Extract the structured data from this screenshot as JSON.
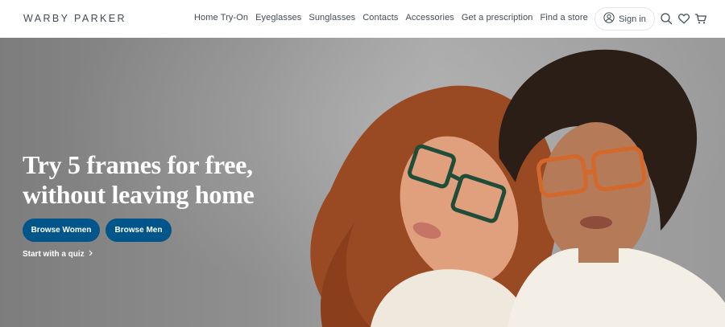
{
  "header": {
    "logo": "WARBY PARKER",
    "nav": [
      {
        "label": "Home Try-On"
      },
      {
        "label": "Eyeglasses"
      },
      {
        "label": "Sunglasses"
      },
      {
        "label": "Contacts"
      },
      {
        "label": "Accessories"
      },
      {
        "label": "Get a prescription"
      },
      {
        "label": "Find a store"
      }
    ],
    "signin_label": "Sign in",
    "icons": [
      "user-icon",
      "search-icon",
      "heart-icon",
      "cart-icon"
    ]
  },
  "hero": {
    "headline_line1": "Try 5 frames for free,",
    "headline_line2": "without leaving home",
    "browse_women": "Browse Women",
    "browse_men": "Browse Men",
    "quiz_link": "Start with a quiz"
  },
  "colors": {
    "brand_blue": "#00558a",
    "text": "#414b56"
  }
}
